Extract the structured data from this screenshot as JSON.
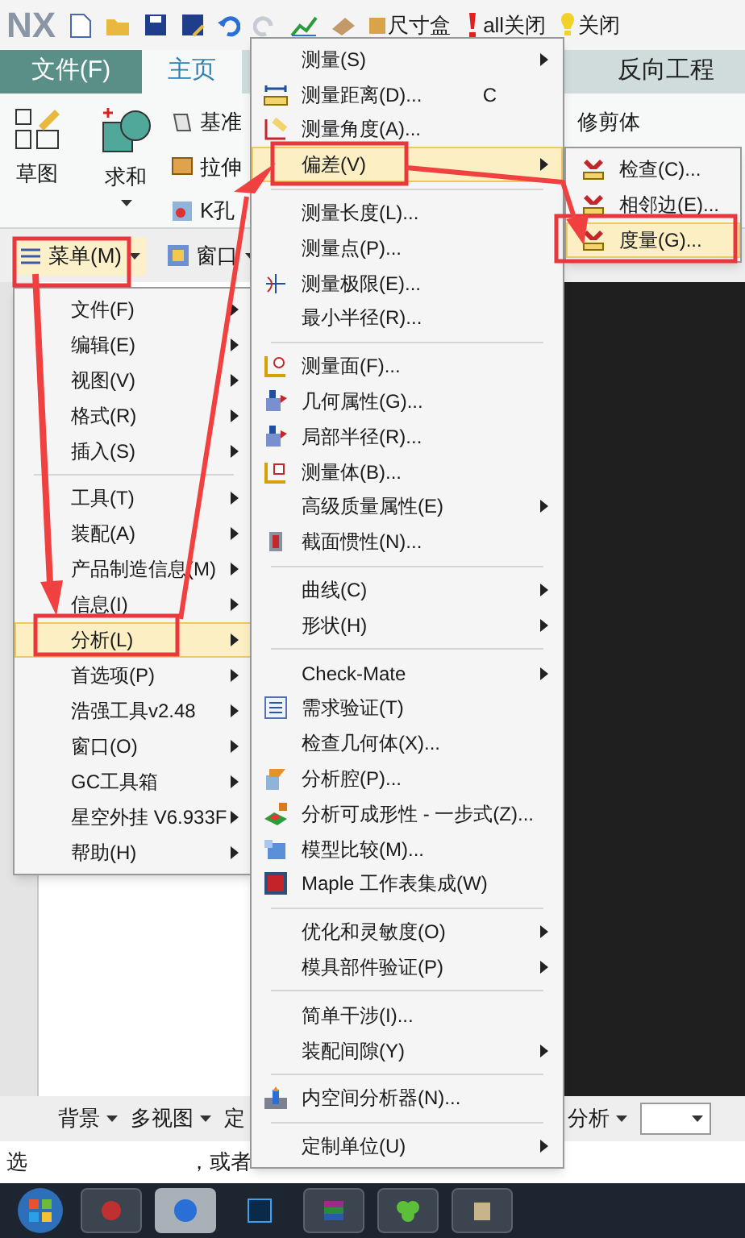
{
  "quick_access": {
    "logo": "NX",
    "items": [
      {
        "label": "尺寸盒"
      },
      {
        "label": "all关闭"
      },
      {
        "label": "关闭"
      }
    ]
  },
  "ribbon": {
    "tabs": [
      {
        "label": "文件(F)",
        "kind": "file",
        "selected": false
      },
      {
        "label": "主页",
        "kind": "tab",
        "selected": true
      },
      {
        "label": "反向工程",
        "kind": "tab",
        "selected": false
      }
    ],
    "commands": [
      {
        "label": "草图"
      },
      {
        "label": "求和"
      },
      {
        "label": "基准"
      },
      {
        "label": "拉伸"
      },
      {
        "label": "K孔"
      },
      {
        "label": "修剪体"
      }
    ]
  },
  "toolbar": {
    "menu_button": "菜单(M)",
    "window_button": "窗口"
  },
  "main_menu": {
    "items": [
      {
        "kind": "item",
        "label": "文件(F)",
        "selected": false
      },
      {
        "kind": "item",
        "label": "编辑(E)",
        "selected": false
      },
      {
        "kind": "item",
        "label": "视图(V)",
        "selected": false
      },
      {
        "kind": "item",
        "label": "格式(R)",
        "selected": false
      },
      {
        "kind": "item",
        "label": "插入(S)",
        "selected": false
      },
      {
        "kind": "separator"
      },
      {
        "kind": "item",
        "label": "工具(T)",
        "selected": false
      },
      {
        "kind": "item",
        "label": "装配(A)",
        "selected": false
      },
      {
        "kind": "item",
        "label": "产品制造信息(M)",
        "selected": false
      },
      {
        "kind": "item",
        "label": "信息(I)",
        "selected": false
      },
      {
        "kind": "item",
        "label": "分析(L)",
        "selected": true
      },
      {
        "kind": "item",
        "label": "首选项(P)",
        "selected": false
      },
      {
        "kind": "item",
        "label": "浩强工具v2.48",
        "selected": false
      },
      {
        "kind": "item",
        "label": "窗口(O)",
        "selected": false
      },
      {
        "kind": "item",
        "label": "GC工具箱",
        "selected": false
      },
      {
        "kind": "item",
        "label": "星空外挂 V6.933F",
        "selected": false
      },
      {
        "kind": "item",
        "label": "帮助(H)",
        "selected": false
      }
    ]
  },
  "analysis_menu": {
    "items": [
      {
        "kind": "item",
        "label": "测量(S)",
        "submenu": true,
        "selected": false
      },
      {
        "kind": "item",
        "label": "测量距离(D)...",
        "shortcut": "C",
        "submenu": false,
        "selected": false
      },
      {
        "kind": "item",
        "label": "测量角度(A)...",
        "submenu": false,
        "selected": false
      },
      {
        "kind": "item",
        "label": "偏差(V)",
        "submenu": true,
        "selected": true
      },
      {
        "kind": "separator"
      },
      {
        "kind": "item",
        "label": "测量长度(L)...",
        "submenu": false,
        "selected": false
      },
      {
        "kind": "item",
        "label": "测量点(P)...",
        "submenu": false,
        "selected": false
      },
      {
        "kind": "item",
        "label": "测量极限(E)...",
        "submenu": false,
        "selected": false
      },
      {
        "kind": "item",
        "label": "最小半径(R)...",
        "submenu": false,
        "selected": false
      },
      {
        "kind": "separator"
      },
      {
        "kind": "item",
        "label": "测量面(F)...",
        "submenu": false,
        "selected": false
      },
      {
        "kind": "item",
        "label": "几何属性(G)...",
        "submenu": false,
        "selected": false
      },
      {
        "kind": "item",
        "label": "局部半径(R)...",
        "submenu": false,
        "selected": false
      },
      {
        "kind": "item",
        "label": "测量体(B)...",
        "submenu": false,
        "selected": false
      },
      {
        "kind": "item",
        "label": "高级质量属性(E)",
        "submenu": true,
        "selected": false
      },
      {
        "kind": "item",
        "label": "截面惯性(N)...",
        "submenu": false,
        "selected": false
      },
      {
        "kind": "separator"
      },
      {
        "kind": "item",
        "label": "曲线(C)",
        "submenu": true,
        "selected": false
      },
      {
        "kind": "item",
        "label": "形状(H)",
        "submenu": true,
        "selected": false
      },
      {
        "kind": "separator"
      },
      {
        "kind": "item",
        "label": "Check-Mate",
        "submenu": true,
        "selected": false
      },
      {
        "kind": "item",
        "label": "需求验证(T)",
        "submenu": false,
        "selected": false
      },
      {
        "kind": "item",
        "label": "检查几何体(X)...",
        "submenu": false,
        "selected": false
      },
      {
        "kind": "item",
        "label": "分析腔(P)...",
        "submenu": false,
        "selected": false
      },
      {
        "kind": "item",
        "label": "分析可成形性 - 一步式(Z)...",
        "submenu": false,
        "selected": false
      },
      {
        "kind": "item",
        "label": "模型比较(M)...",
        "submenu": false,
        "selected": false
      },
      {
        "kind": "item",
        "label": "Maple 工作表集成(W)",
        "submenu": false,
        "selected": false
      },
      {
        "kind": "separator"
      },
      {
        "kind": "item",
        "label": "优化和灵敏度(O)",
        "submenu": true,
        "selected": false
      },
      {
        "kind": "item",
        "label": "模具部件验证(P)",
        "submenu": true,
        "selected": false
      },
      {
        "kind": "separator"
      },
      {
        "kind": "item",
        "label": "简单干涉(I)...",
        "submenu": false,
        "selected": false
      },
      {
        "kind": "item",
        "label": "装配间隙(Y)",
        "submenu": true,
        "selected": false
      },
      {
        "kind": "separator"
      },
      {
        "kind": "item",
        "label": "内空间分析器(N)...",
        "submenu": false,
        "selected": false
      },
      {
        "kind": "separator"
      },
      {
        "kind": "item",
        "label": "定制单位(U)",
        "submenu": true,
        "selected": false
      }
    ]
  },
  "deviation_menu": {
    "items": [
      {
        "label": "检查(C)...",
        "selected": false
      },
      {
        "label": "相邻边(E)...",
        "selected": false
      },
      {
        "label": "度量(G)...",
        "selected": true
      }
    ]
  },
  "bottom_toolbar": {
    "items": [
      {
        "label": "背景"
      },
      {
        "label": "多视图"
      },
      {
        "label": "定"
      },
      {
        "label": "分析"
      }
    ]
  },
  "status_bar": {
    "parts": [
      "选",
      "，或者"
    ]
  }
}
